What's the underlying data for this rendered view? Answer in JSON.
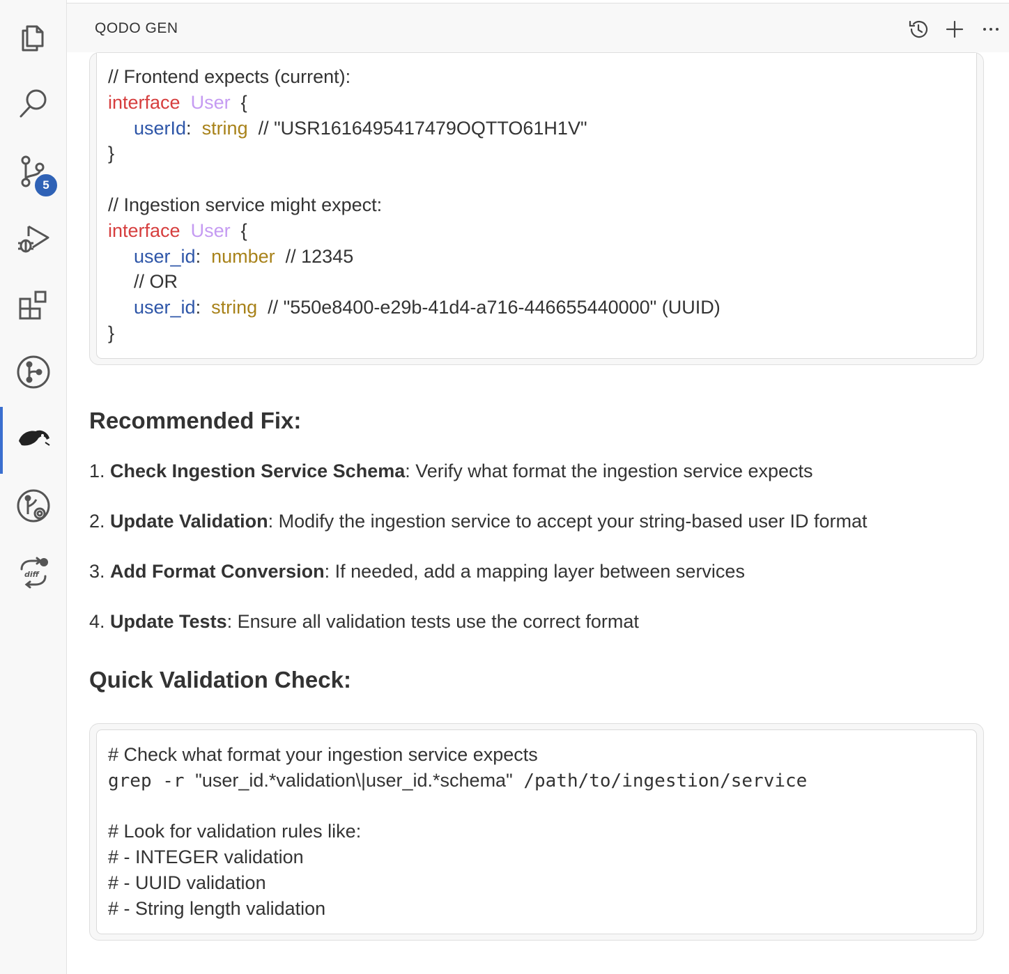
{
  "activity_bar": {
    "items": [
      {
        "name": "explorer-icon"
      },
      {
        "name": "search-icon"
      },
      {
        "name": "source-control-icon",
        "badge": "5"
      },
      {
        "name": "run-debug-icon"
      },
      {
        "name": "extensions-icon"
      },
      {
        "name": "git-graph-icon"
      },
      {
        "name": "qodo-gen-icon",
        "active": true
      },
      {
        "name": "git-lens-icon"
      },
      {
        "name": "diff-sync-icon"
      }
    ]
  },
  "panel": {
    "title": "QODO GEN",
    "actions": [
      "history-icon",
      "new-chat-icon",
      "more-actions-icon"
    ]
  },
  "code_block_1": {
    "lines": [
      {
        "parts": [
          {
            "t": "// Frontend expects (current):",
            "c": "cm"
          }
        ]
      },
      {
        "parts": [
          {
            "t": "interface",
            "c": "kw"
          },
          {
            "t": "  "
          },
          {
            "t": "User",
            "c": "tp"
          },
          {
            "t": "  {"
          }
        ]
      },
      {
        "indent": true,
        "parts": [
          {
            "t": "userId",
            "c": "prop"
          },
          {
            "t": ":  "
          },
          {
            "t": "string",
            "c": "str"
          },
          {
            "t": "  // \"USR1616495417479OQTTO61H1V\"",
            "c": "cm"
          }
        ]
      },
      {
        "parts": [
          {
            "t": "}"
          }
        ]
      },
      {
        "parts": [
          {
            "t": ""
          }
        ]
      },
      {
        "parts": [
          {
            "t": "// Ingestion service might expect:",
            "c": "cm"
          }
        ]
      },
      {
        "parts": [
          {
            "t": "interface",
            "c": "kw"
          },
          {
            "t": "  "
          },
          {
            "t": "User",
            "c": "tp"
          },
          {
            "t": "  {"
          }
        ]
      },
      {
        "indent": true,
        "parts": [
          {
            "t": "user_id",
            "c": "prop"
          },
          {
            "t": ":  "
          },
          {
            "t": "number",
            "c": "str"
          },
          {
            "t": "  // 12345",
            "c": "cm"
          }
        ]
      },
      {
        "indent": true,
        "parts": [
          {
            "t": "// OR",
            "c": "cm"
          }
        ]
      },
      {
        "indent": true,
        "parts": [
          {
            "t": "user_id",
            "c": "prop"
          },
          {
            "t": ":  "
          },
          {
            "t": "string",
            "c": "str"
          },
          {
            "t": "  // \"550e8400-e29b-41d4-a716-446655440000\" (UUID)",
            "c": "cm"
          }
        ]
      },
      {
        "parts": [
          {
            "t": "}"
          }
        ]
      }
    ]
  },
  "recommended_fix": {
    "heading": "Recommended Fix:",
    "items": [
      {
        "num": "1.",
        "title": "Check Ingestion Service Schema",
        "text": ": Verify what format the ingestion service expects"
      },
      {
        "num": "2.",
        "title": "Update Validation",
        "text": ": Modify the ingestion service to accept your string-based user ID format"
      },
      {
        "num": "3.",
        "title": "Add Format Conversion",
        "text": ": If needed, add a mapping layer between services"
      },
      {
        "num": "4.",
        "title": "Update Tests",
        "text": ": Ensure all validation tests use the correct format"
      }
    ]
  },
  "quick_check": {
    "heading": "Quick Validation Check:"
  },
  "code_block_2": {
    "lines": [
      {
        "parts": [
          {
            "t": "# Check what format your ingestion service expects"
          }
        ]
      },
      {
        "parts": [
          {
            "t": "grep -r ",
            "m": true
          },
          {
            "t": "\"user_id.*validation\\|user_id.*schema\""
          },
          {
            "t": " /path/to/ingestion/service",
            "m": true
          }
        ]
      },
      {
        "parts": [
          {
            "t": ""
          }
        ]
      },
      {
        "parts": [
          {
            "t": "# Look for validation rules like:"
          }
        ]
      },
      {
        "parts": [
          {
            "t": "# - INTEGER validation"
          }
        ]
      },
      {
        "parts": [
          {
            "t": "# - UUID validation"
          }
        ]
      },
      {
        "parts": [
          {
            "t": "# - String length validation"
          }
        ]
      }
    ]
  }
}
